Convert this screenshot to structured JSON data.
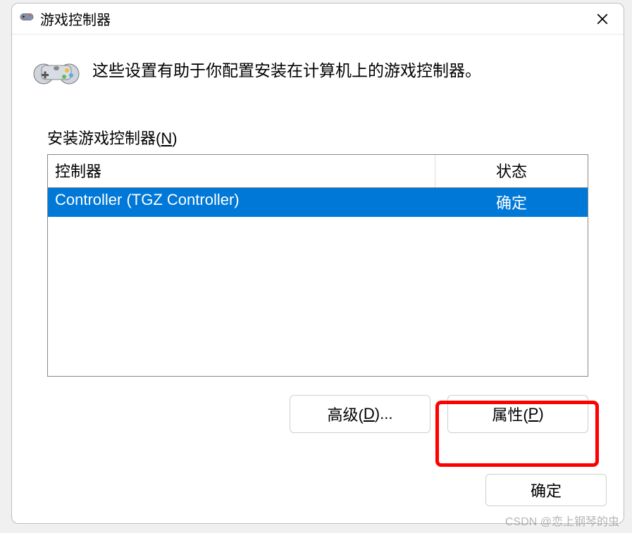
{
  "dialog": {
    "title": "游戏控制器",
    "header_text": "这些设置有助于你配置安装在计算机上的游戏控制器。",
    "section_label_prefix": "安装游戏控制器(",
    "section_label_key": "N",
    "section_label_suffix": ")",
    "columns": {
      "controller": "控制器",
      "status": "状态"
    },
    "rows": [
      {
        "controller": "Controller (TGZ Controller)",
        "status": "确定",
        "selected": true
      }
    ],
    "buttons": {
      "advanced_prefix": "高级(",
      "advanced_key": "D",
      "advanced_suffix": ")...",
      "properties_prefix": "属性(",
      "properties_key": "P",
      "properties_suffix": ")",
      "ok": "确定"
    }
  },
  "watermark": "CSDN @恋上钢琴的虫"
}
